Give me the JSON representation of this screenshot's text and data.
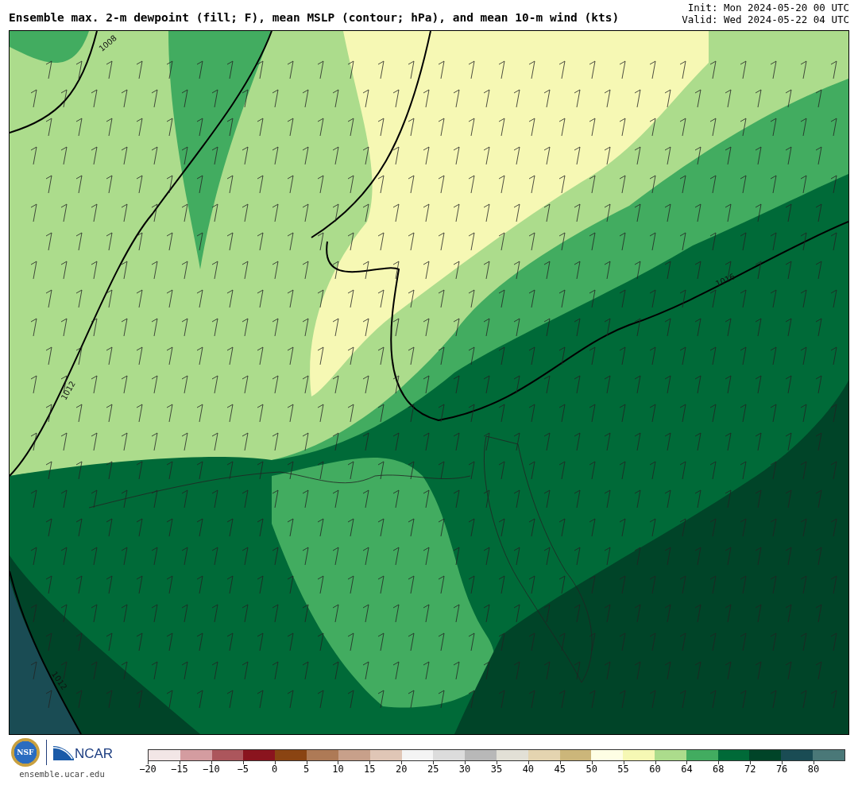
{
  "header": {
    "title": "Ensemble max. 2-m dewpoint (fill; F), mean MSLP (contour; hPa), and mean 10-m wind (kts)",
    "init": "Init: Mon 2024-05-20 00 UTC",
    "valid": "Valid: Wed 2024-05-22 04 UTC"
  },
  "map": {
    "contour_labels": [
      "1008",
      "1012",
      "1016",
      "1012"
    ]
  },
  "footer": {
    "nsf": "NSF",
    "ncar": "NCAR",
    "site": "ensemble.ucar.edu"
  },
  "colorbar": {
    "bins": [
      {
        "label": "−20",
        "color": "#f2e6e6"
      },
      {
        "label": "−15",
        "color": "#d49ca0"
      },
      {
        "label": "−10",
        "color": "#ac565c"
      },
      {
        "label": "−5",
        "color": "#8a141e"
      },
      {
        "label": "0",
        "color": "#8a4412"
      },
      {
        "label": "5",
        "color": "#ae7a56"
      },
      {
        "label": "10",
        "color": "#c8a08a"
      },
      {
        "label": "15",
        "color": "#e0c6b6"
      },
      {
        "label": "20",
        "color": "#f4f4f4"
      },
      {
        "label": "25",
        "color": "#dcdcdc"
      },
      {
        "label": "30",
        "color": "#b8b8b8"
      },
      {
        "label": "35",
        "color": "#e2e0d6"
      },
      {
        "label": "40",
        "color": "#e4d4b0"
      },
      {
        "label": "45",
        "color": "#ccb67a"
      },
      {
        "label": "50",
        "color": "#fefee4"
      },
      {
        "label": "55",
        "color": "#f6f8b4"
      },
      {
        "label": "60",
        "color": "#acdc8c"
      },
      {
        "label": "64",
        "color": "#42ac60"
      },
      {
        "label": "68",
        "color": "#006a38"
      },
      {
        "label": "72",
        "color": "#004428"
      },
      {
        "label": "76",
        "color": "#1a4c54"
      },
      {
        "label": "80",
        "color": "#4a7878"
      }
    ]
  }
}
